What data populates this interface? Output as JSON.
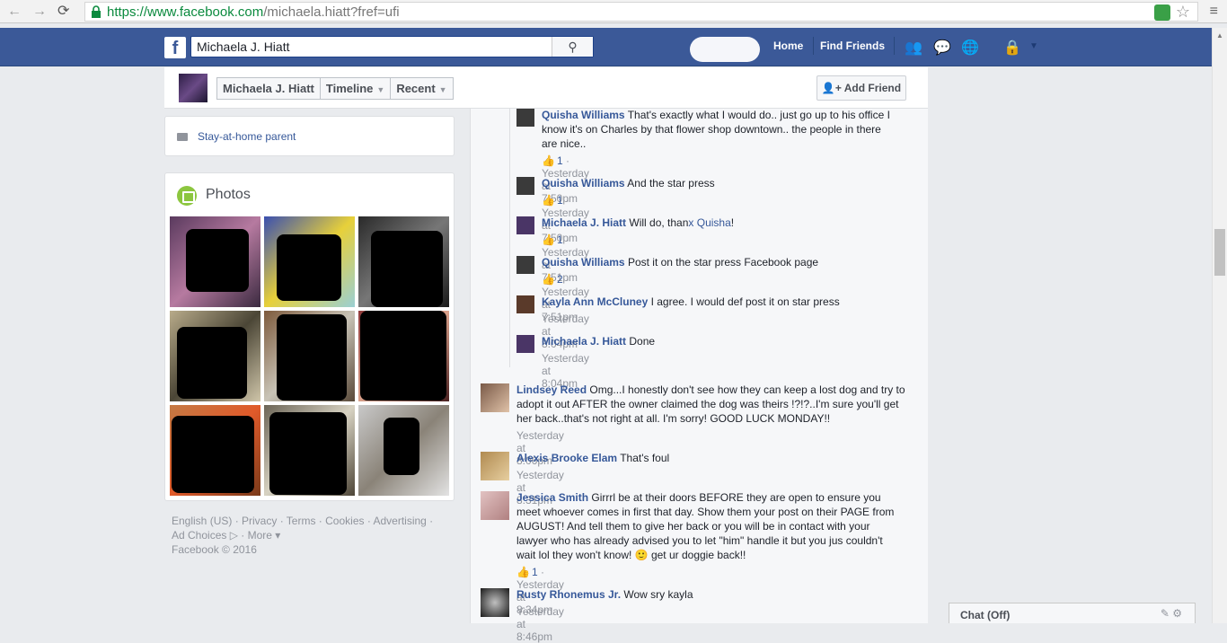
{
  "browser": {
    "url_host": "https://www.facebook.com",
    "url_path": "/michaela.hiatt?fref=ufi"
  },
  "topbar": {
    "search_value": "Michaela J. Hiatt",
    "home": "Home",
    "find_friends": "Find Friends"
  },
  "header": {
    "name": "Michaela J. Hiatt",
    "timeline": "Timeline",
    "recent": "Recent",
    "add_friend": "Add Friend"
  },
  "intro": {
    "work": "Stay-at-home parent"
  },
  "photos": {
    "title": "Photos"
  },
  "footer": {
    "line1": "English (US) · Privacy · Terms · Cookies · Advertising ·",
    "line2": "Ad Choices ▷ · More ▾",
    "line3": "Facebook © 2016"
  },
  "comments": [
    {
      "name": "Quisha Williams",
      "text": "That's exactly what I would do.. just go up to his office I",
      "text2": "know it's on Charles by that flower shop downtown.. the people in there",
      "text3": "are nice..",
      "likes": "1",
      "time": "Yesterday at 7:50pm"
    },
    {
      "name": "Quisha Williams",
      "text": "And the star press",
      "likes": "1",
      "time": "Yesterday at 7:50pm"
    },
    {
      "name": "Michaela J. Hiatt",
      "text_a": "Will do, than",
      "text_b": "x Quisha",
      "text_c": "!",
      "likes": "1",
      "time": "Yesterday at 7:51pm"
    },
    {
      "name": "Quisha Williams",
      "text": "Post it on the star press Facebook page",
      "likes": "2",
      "time": "Yesterday at 7:51pm"
    },
    {
      "name": "Kayla Ann McCluney",
      "text": "I agree. I would def post it on star press",
      "time": "Yesterday at 8:04pm"
    },
    {
      "name": "Michaela J. Hiatt",
      "text": "Done",
      "time": "Yesterday at 8:04pm"
    },
    {
      "name": "Lindsey Reed",
      "text": "Omg...I honestly don't see how they can keep a lost dog and try to",
      "text2": "adopt it out AFTER the owner claimed the dog was theirs !?!?..I'm sure you'll get",
      "text3": "her back..that's not right at all. I'm sorry! GOOD LUCK MONDAY!!",
      "time": "Yesterday at 8:06pm"
    },
    {
      "name": "Alexis Brooke Elam",
      "text": "That's foul",
      "time": "Yesterday at 8:31pm"
    },
    {
      "name": "Jessica Smith",
      "text": "Girrrl be at their doors BEFORE they are open to ensure you",
      "text2": "meet whoever comes in first that day. Show them your post on their PAGE from",
      "text3": "AUGUST! And tell them to give her back or you will be in contact with your",
      "text4": "lawyer who has already advised you to let \"him\" handle it but you jus couldn't",
      "text5": "wait lol they won't know! 🙂 get ur doggie back!!",
      "likes": "1",
      "time": "Yesterday at 8:34pm"
    },
    {
      "name": "Rusty Rhonemus Jr.",
      "text": "Wow sry kayla",
      "time": "Yesterday at 8:46pm"
    }
  ],
  "chat": {
    "label": "Chat (Off)"
  }
}
